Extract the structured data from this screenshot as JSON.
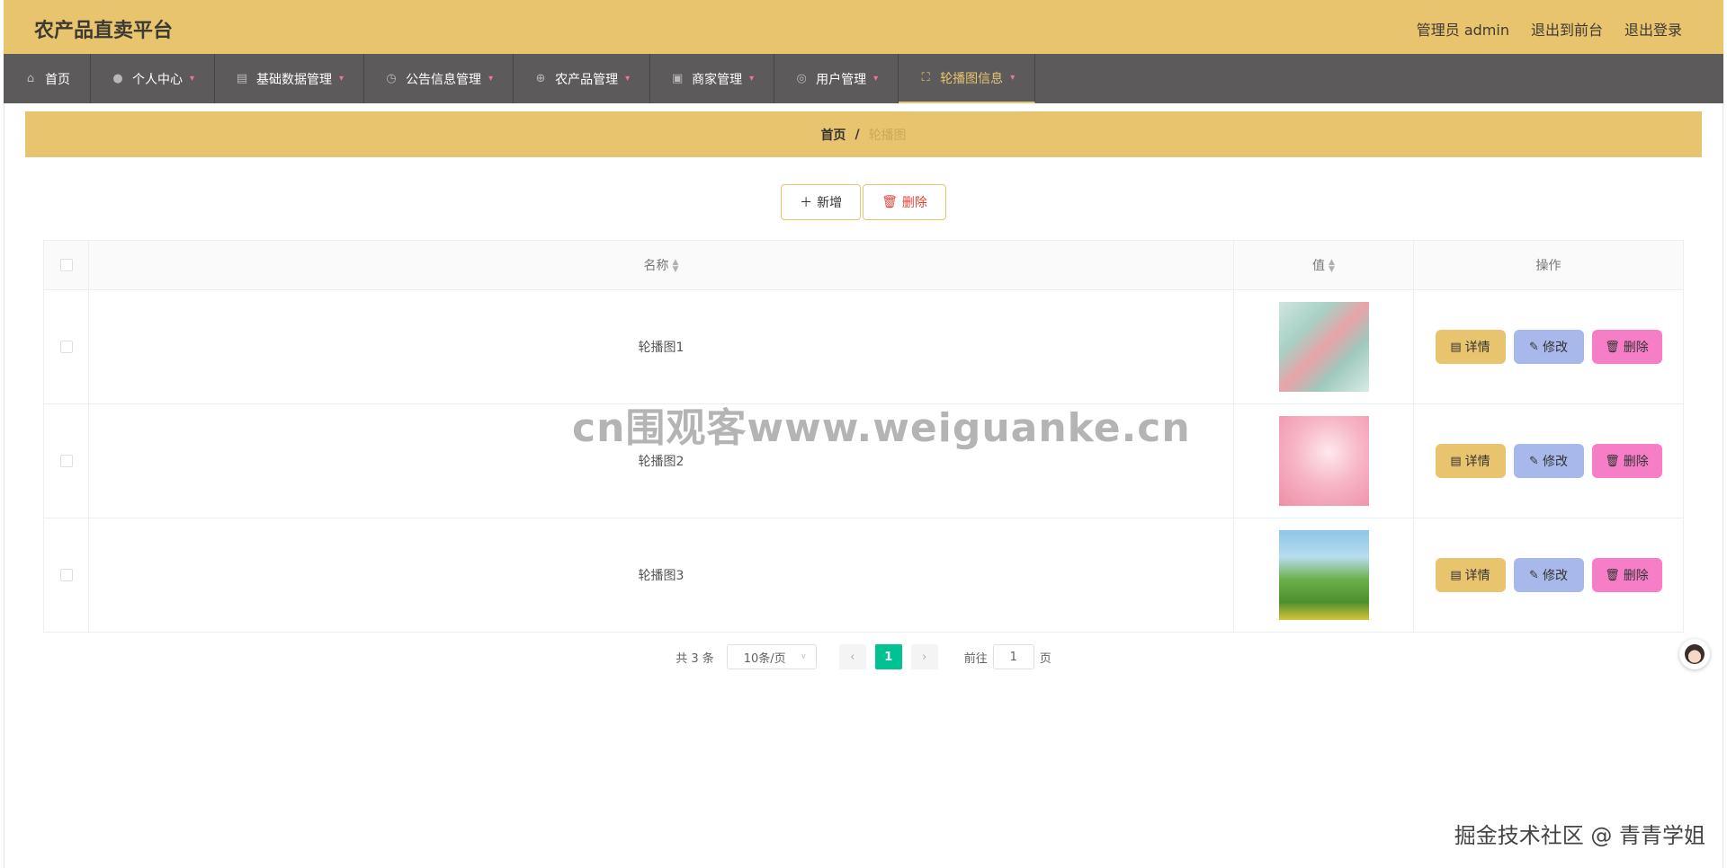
{
  "header": {
    "title": "农产品直卖平台",
    "user": "管理员 admin",
    "to_front": "退出到前台",
    "logout": "退出登录"
  },
  "nav": [
    {
      "label": "首页",
      "icon": "home-icon",
      "has_caret": false
    },
    {
      "label": "个人中心",
      "icon": "user-icon",
      "has_caret": true
    },
    {
      "label": "基础数据管理",
      "icon": "clipboard-icon",
      "has_caret": true
    },
    {
      "label": "公告信息管理",
      "icon": "clock-icon",
      "has_caret": true
    },
    {
      "label": "农产品管理",
      "icon": "crosshair-icon",
      "has_caret": true
    },
    {
      "label": "商家管理",
      "icon": "shop-icon",
      "has_caret": true
    },
    {
      "label": "用户管理",
      "icon": "lifebuoy-icon",
      "has_caret": true
    },
    {
      "label": "轮播图信息",
      "icon": "fullscreen-icon",
      "has_caret": true,
      "active": true
    }
  ],
  "breadcrumb": {
    "home": "首页",
    "sep": "/",
    "current": "轮播图"
  },
  "toolbar": {
    "add_label": "新增",
    "delete_label": "删除"
  },
  "table": {
    "headers": {
      "name": "名称",
      "value": "值",
      "ops": "操作"
    },
    "rows": [
      {
        "name": "轮播图1",
        "image": "thumb1"
      },
      {
        "name": "轮播图2",
        "image": "thumb2"
      },
      {
        "name": "轮播图3",
        "image": "thumb3"
      }
    ],
    "ops": {
      "detail": "详情",
      "edit": "修改",
      "delete": "删除"
    }
  },
  "pager": {
    "total": "共 3 条",
    "page_size": "10条/页",
    "current_page": "1",
    "goto_prefix": "前往",
    "goto_value": "1",
    "goto_suffix": "页"
  },
  "watermark": "cn围观客www.weiguanke.cn",
  "credit": "掘金技术社区 @ 青青学姐",
  "colors": {
    "accent": "#e8c46e",
    "nav_bg": "#5c5a5b",
    "page_active": "#00c292",
    "edit": "#a9b8ea",
    "delete": "#f57ec7"
  }
}
